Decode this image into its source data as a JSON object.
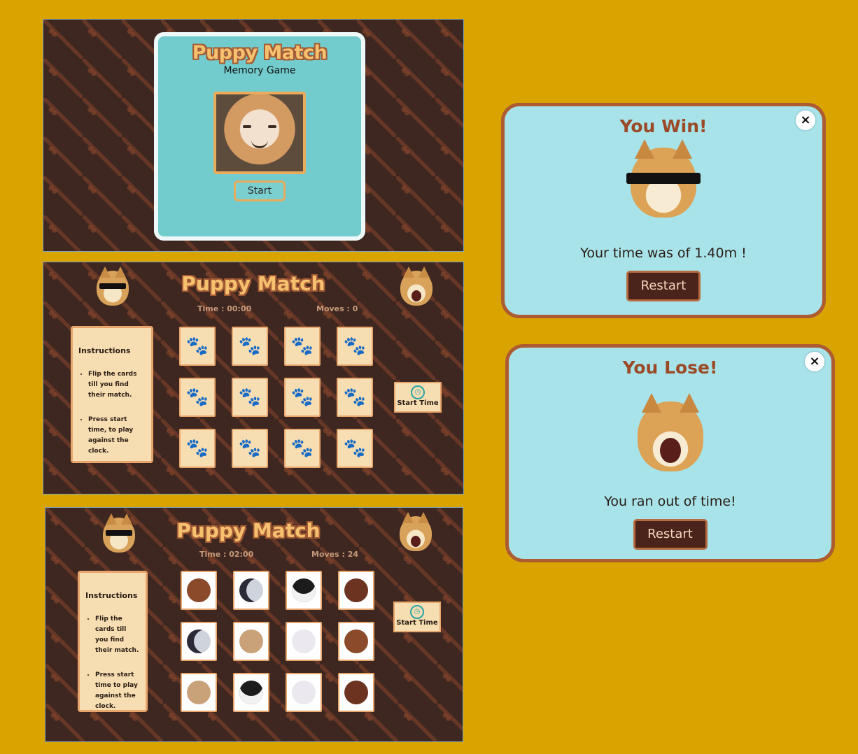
{
  "start_screen": {
    "title": "Puppy Match",
    "subtitle": "Memory Game",
    "start_label": "Start",
    "photo_icon": "smiling-shiba-photo"
  },
  "game_screen_1": {
    "title": "Puppy Match",
    "time": "Time : 00:00",
    "moves": "Moves : 0",
    "instructions_title": "Instructions",
    "instructions": [
      "Flip the cards till you find their match.",
      "Press start time, to play against the clock."
    ],
    "timer_label": "Start Time",
    "cards": [
      "🐾",
      "🐾",
      "🐾",
      "🐾",
      "🐾",
      "🐾",
      "🐾",
      "🐾",
      "🐾",
      "🐾",
      "🐾",
      "🐾"
    ]
  },
  "game_screen_2": {
    "title": "Puppy Match",
    "time": "Time : 02:00",
    "moves": "Moves : 24",
    "instructions_title": "Instructions",
    "instructions": [
      "Flip the cards till you find their match.",
      "Press start time to play against the clock."
    ],
    "timer_label": "Start Time",
    "cards": [
      "basset-hound",
      "jack-russell",
      "border-collie",
      "dachshund",
      "jack-russell",
      "french-bulldog",
      "bulldog",
      "basset-hound",
      "french-bulldog",
      "border-collie",
      "bulldog",
      "dachshund"
    ]
  },
  "win_modal": {
    "title": "You Win!",
    "message": "Your time was of 1.40m !",
    "restart_label": "Restart",
    "close_label": "×"
  },
  "lose_modal": {
    "title": "You Lose!",
    "message": "You ran out of time!",
    "restart_label": "Restart",
    "close_label": "×"
  },
  "colors": {
    "page_bg": "#d9a300",
    "panel_bg": "#3e2720",
    "card_bg": "#f6ddb2",
    "modal_bg": "#a7e3e9",
    "accent_brown": "#ad5c32"
  }
}
